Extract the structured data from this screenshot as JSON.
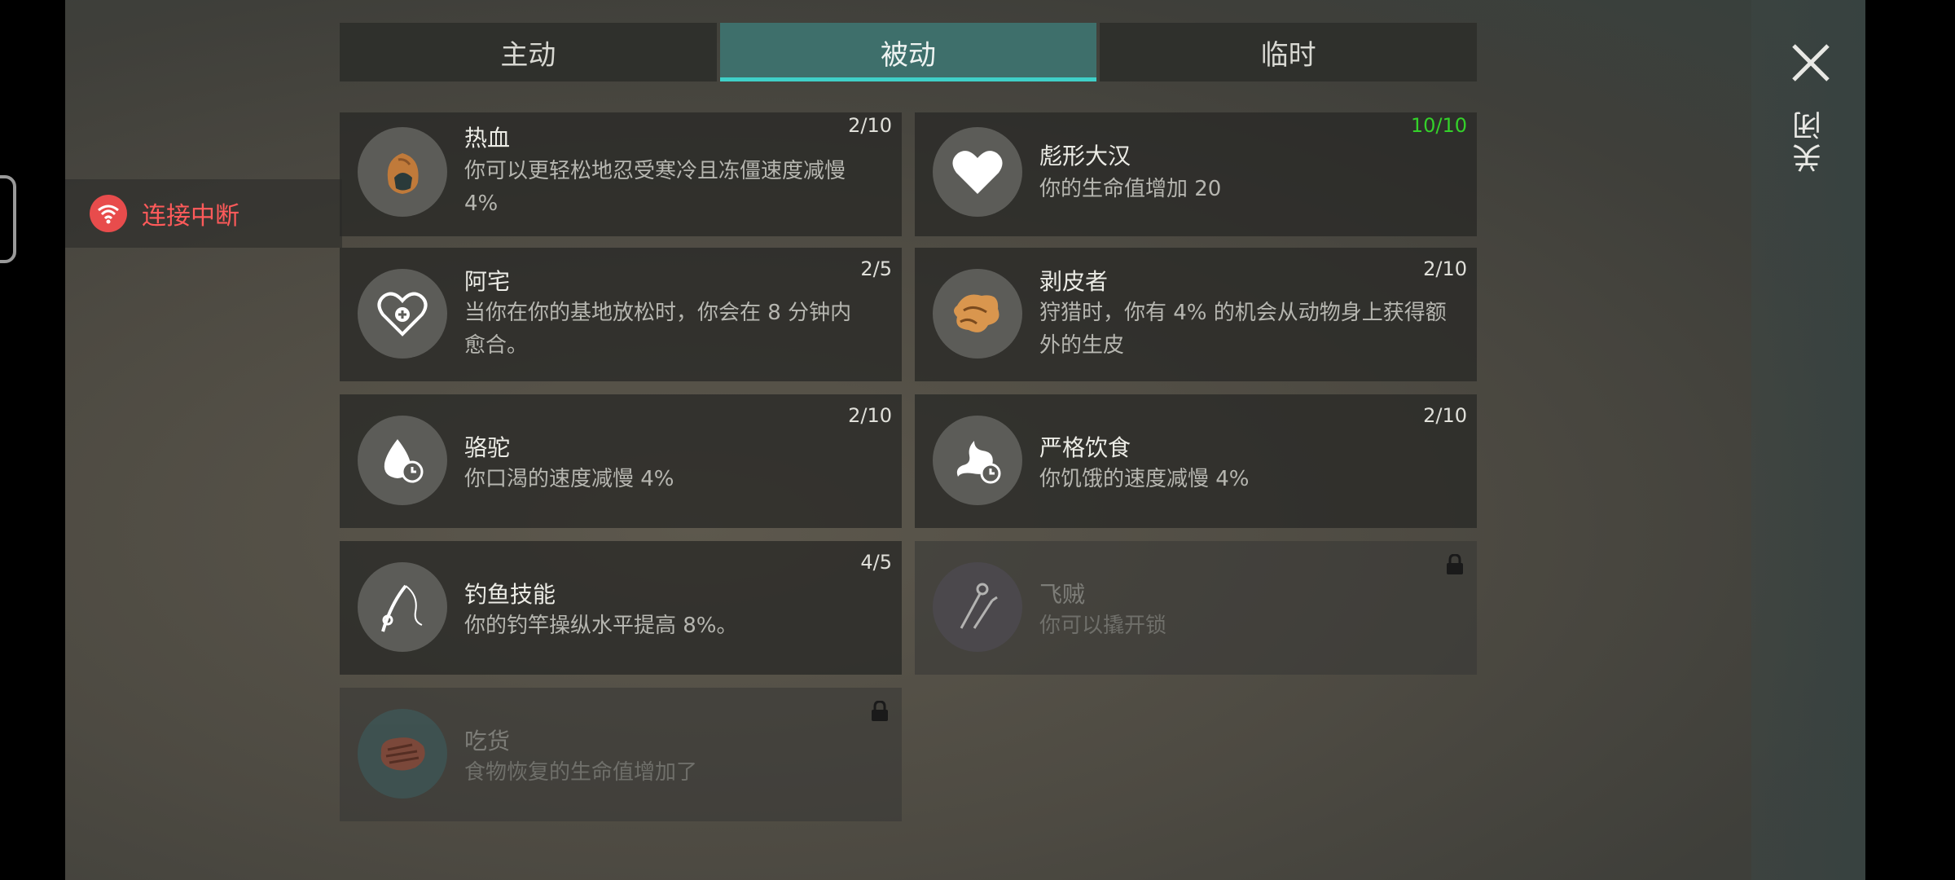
{
  "status": {
    "text": "连接中断",
    "color": "#e84c4c"
  },
  "tabs": [
    {
      "label": "主动",
      "active": false
    },
    {
      "label": "被动",
      "active": true
    },
    {
      "label": "临时",
      "active": false
    }
  ],
  "close": {
    "label": "关闭"
  },
  "skills": [
    {
      "name": "热血",
      "desc": "你可以更轻松地忍受寒冷且冻僵速度减慢 4%",
      "level": "2/10",
      "icon": "hood-icon"
    },
    {
      "name": "彪形大汉",
      "desc": "你的生命值增加 20",
      "level": "10/10",
      "icon": "heart-icon"
    },
    {
      "name": "阿宅",
      "desc": "当你在你的基地放松时，你会在 8 分钟内愈合。",
      "level": "2/5",
      "icon": "heart-plus-icon"
    },
    {
      "name": "剥皮者",
      "desc": "狩猎时，你有 4% 的机会从动物身上获得额外的生皮",
      "level": "2/10",
      "icon": "hide-icon"
    },
    {
      "name": "骆驼",
      "desc": "你口渴的速度减慢 4%",
      "level": "2/10",
      "icon": "drop-timer-icon"
    },
    {
      "name": "严格饮食",
      "desc": "你饥饿的速度减慢 4%",
      "level": "2/10",
      "icon": "stomach-timer-icon"
    },
    {
      "name": "钓鱼技能",
      "desc": "你的钓竿操纵水平提高 8%。",
      "level": "4/5",
      "icon": "fishing-rod-icon"
    },
    {
      "name": "飞贼",
      "desc": "你可以撬开锁",
      "level": "",
      "icon": "lockpick-icon",
      "locked": true
    },
    {
      "name": "吃货",
      "desc": "食物恢复的生命值增加了",
      "level": "",
      "icon": "steak-icon",
      "locked": true
    }
  ]
}
